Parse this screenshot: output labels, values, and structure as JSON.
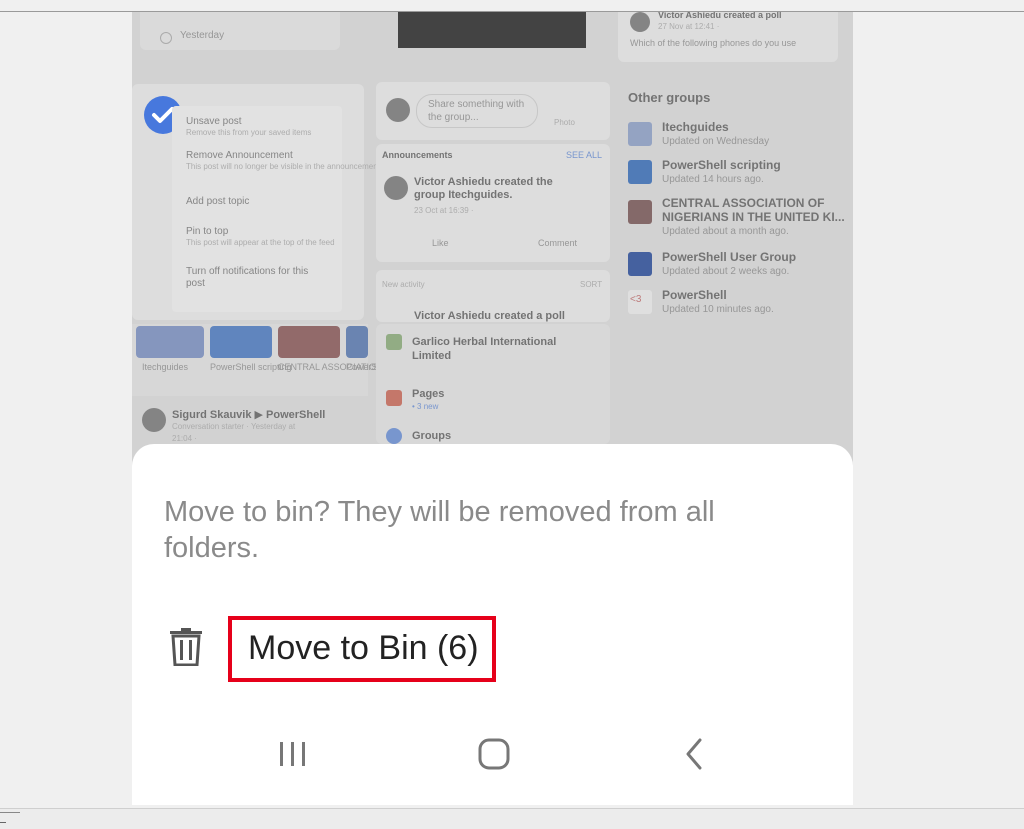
{
  "sheet": {
    "message": "Move to bin? They will be removed from all folders.",
    "action_label": "Move to Bin (6)"
  },
  "background": {
    "topcard_time": "Yesterday",
    "poll_author": "Victor Ashiedu created a poll",
    "poll_time": "27 Nov at 12:41 · ",
    "poll_question": "Which of the following phones do you use",
    "menu_items": [
      {
        "title": "Unsave post",
        "sub": "Remove this from your saved items"
      },
      {
        "title": "Remove Announcement",
        "sub": "This post will no longer be visible in the announcements section"
      },
      {
        "title": "Add post topic",
        "sub": ""
      },
      {
        "title": "Pin to top",
        "sub": "This post will appear at the top of the feed"
      },
      {
        "title": "Turn off notifications for this",
        "sub": "post"
      }
    ],
    "share_prompt": "Share something with the group...",
    "photo_label": "Photo",
    "announcements_label": "Announcements",
    "see_all_label": "SEE ALL",
    "ann_author": "Victor Ashiedu created the group Itechguides.",
    "ann_time": "23 Oct at 16:39 · ",
    "like_label": "Like",
    "comment_label": "Comment",
    "new_activity_label": "New activity",
    "sort_label": "SORT",
    "activity_peek": "Victor Ashiedu created a poll",
    "other_groups_title": "Other groups",
    "groups": [
      {
        "name": "Itechguides",
        "updated": "Updated on Wednesday"
      },
      {
        "name": "PowerShell scripting",
        "updated": "Updated 14 hours ago."
      },
      {
        "name": "CENTRAL ASSOCIATION OF",
        "name2": "NIGERIANS IN THE UNITED KI...",
        "updated": "Updated about a month ago."
      },
      {
        "name": "PowerShell User Group",
        "updated": "Updated about 2 weeks ago."
      },
      {
        "name": "PowerShell",
        "updated": "Updated 10 minutes ago."
      }
    ],
    "tiles": [
      "Itechguides",
      "PowerShell scripting",
      "CENTRAL ASSOCIATIO...",
      "PowerShell User"
    ],
    "conv_author": "Sigurd Skauvik ▶ PowerShell",
    "conv_sub": "Conversation starter · Yesterday at",
    "conv_time": "21:04 · ",
    "shortcuts": [
      {
        "label": "Garlico Herbal International",
        "label2": "Limited"
      },
      {
        "label": "Pages",
        "sub": "• 3 new"
      },
      {
        "label": "Groups"
      }
    ]
  }
}
